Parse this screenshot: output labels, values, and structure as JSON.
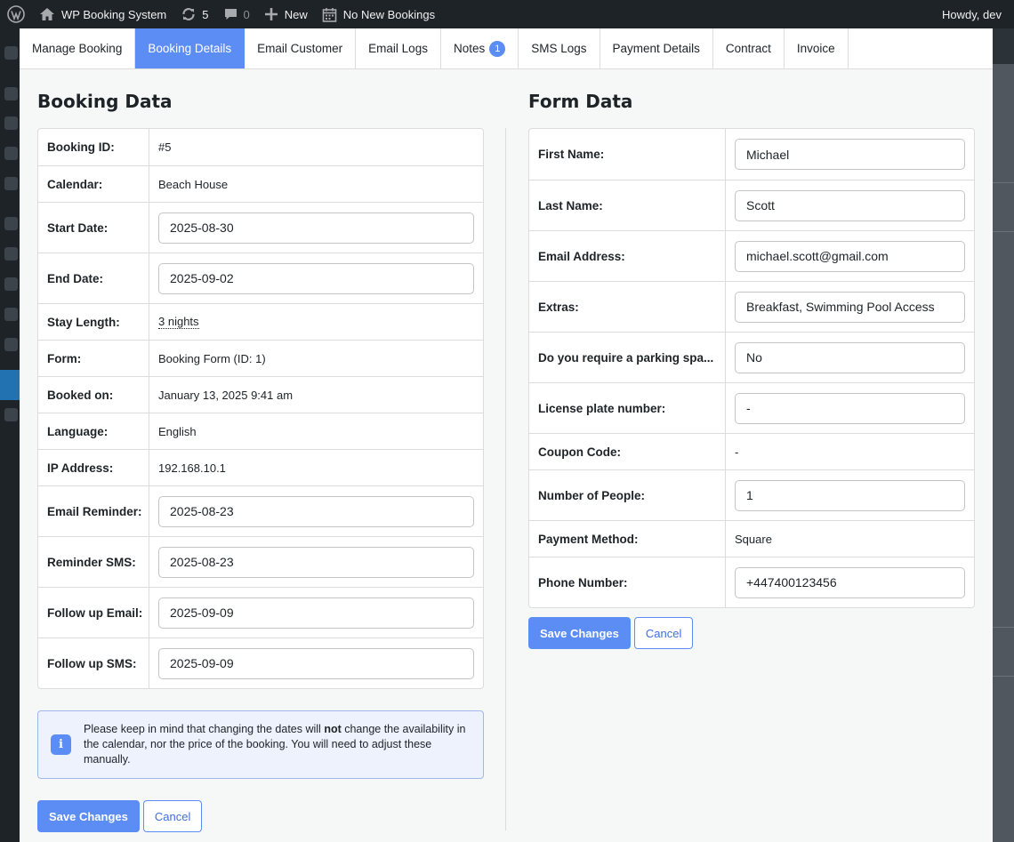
{
  "admin_bar": {
    "site_name": "WP Booking System",
    "updates_count": "5",
    "comments_count": "0",
    "new_label": "New",
    "bookings_label": "No New Bookings",
    "greeting": "Howdy, dev"
  },
  "tabs": [
    {
      "label": "Manage Booking"
    },
    {
      "label": "Booking Details",
      "active": true
    },
    {
      "label": "Email Customer"
    },
    {
      "label": "Email Logs"
    },
    {
      "label": "Notes",
      "badge": "1"
    },
    {
      "label": "SMS Logs"
    },
    {
      "label": "Payment Details"
    },
    {
      "label": "Contract"
    },
    {
      "label": "Invoice"
    }
  ],
  "booking_data": {
    "title": "Booking Data",
    "booking_id": {
      "label": "Booking ID:",
      "value": "#5"
    },
    "calendar": {
      "label": "Calendar:",
      "value": "Beach House"
    },
    "start_date": {
      "label": "Start Date:",
      "value": "2025-08-30"
    },
    "end_date": {
      "label": "End Date:",
      "value": "2025-09-02"
    },
    "stay_length": {
      "label": "Stay Length:",
      "value": "3 nights"
    },
    "form": {
      "label": "Form:",
      "value": "Booking Form (ID: 1)"
    },
    "booked_on": {
      "label": "Booked on:",
      "value": "January 13, 2025 9:41 am"
    },
    "language": {
      "label": "Language:",
      "value": "English"
    },
    "ip_address": {
      "label": "IP Address:",
      "value": "192.168.10.1"
    },
    "email_reminder": {
      "label": "Email Reminder:",
      "value": "2025-08-23"
    },
    "reminder_sms": {
      "label": "Reminder SMS:",
      "value": "2025-08-23"
    },
    "follow_up_email": {
      "label": "Follow up Email:",
      "value": "2025-09-09"
    },
    "follow_up_sms": {
      "label": "Follow up SMS:",
      "value": "2025-09-09"
    },
    "notice": {
      "before": "Please keep in mind that changing the dates will ",
      "bold": "not",
      "after": " change the availability in the calendar, nor the price of the booking. You will need to adjust these manually."
    },
    "save_label": "Save Changes",
    "cancel_label": "Cancel"
  },
  "form_data": {
    "title": "Form Data",
    "first_name": {
      "label": "First Name:",
      "value": "Michael"
    },
    "last_name": {
      "label": "Last Name:",
      "value": "Scott"
    },
    "email": {
      "label": "Email Address:",
      "value": "michael.scott@gmail.com"
    },
    "extras": {
      "label": "Extras:",
      "value": "Breakfast, Swimming Pool Access"
    },
    "parking": {
      "label": "Do you require a parking spa...",
      "value": "No"
    },
    "license_plate": {
      "label": "License plate number:",
      "value": "-"
    },
    "coupon": {
      "label": "Coupon Code:",
      "value": "-"
    },
    "people": {
      "label": "Number of People:",
      "value": "1"
    },
    "payment_method": {
      "label": "Payment Method:",
      "value": "Square"
    },
    "phone": {
      "label": "Phone Number:",
      "value": "+447400123456"
    },
    "save_label": "Save Changes",
    "cancel_label": "Cancel"
  },
  "colors": {
    "accent": "#5b8df5",
    "admin_bar": "#1d2327",
    "notice_bg": "#eef2fd"
  }
}
